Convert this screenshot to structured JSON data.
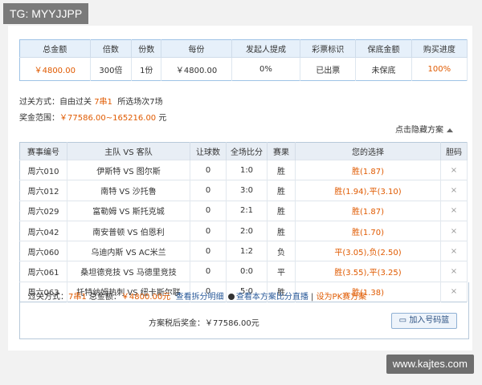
{
  "watermark_top": "TG: MYYJJPP",
  "watermark_bottom": "www.kajtes.com",
  "summary": {
    "headers": [
      "总金额",
      "倍数",
      "份数",
      "每份",
      "发起人提成",
      "彩票标识",
      "保底金额",
      "购买进度"
    ],
    "values": [
      "￥4800.00",
      "300倍",
      "1份",
      "￥4800.00",
      "0%",
      "已出票",
      "未保底",
      "100%"
    ]
  },
  "pass_mode_label": "过关方式：自由过关",
  "pass_mode_value": "7串1",
  "pass_mode_extra": "所选场次7场",
  "prize_range_label": "奖金范围：",
  "prize_range_value": "￥77586.00~165216.00",
  "prize_range_unit": "元",
  "toggle_label": "点击隐藏方案",
  "matches": {
    "headers": [
      "赛事编号",
      "主队 VS 客队",
      "让球数",
      "全场比分",
      "赛果",
      "您的选择",
      "胆码"
    ],
    "rows": [
      {
        "id": "周六010",
        "teams": "伊斯特 VS 图尔斯",
        "handicap": "0",
        "score": "1:0",
        "result": "胜",
        "choice": "胜(1.87)",
        "dan": "×"
      },
      {
        "id": "周六012",
        "teams": "南特 VS 沙托鲁",
        "handicap": "0",
        "score": "3:0",
        "result": "胜",
        "choice": "胜(1.94),平(3.10)",
        "dan": "×"
      },
      {
        "id": "周六029",
        "teams": "富勒姆 VS 斯托克城",
        "handicap": "0",
        "score": "2:1",
        "result": "胜",
        "choice": "胜(1.87)",
        "dan": "×"
      },
      {
        "id": "周六042",
        "teams": "南安普顿 VS 伯恩利",
        "handicap": "0",
        "score": "2:0",
        "result": "胜",
        "choice": "胜(1.70)",
        "dan": "×"
      },
      {
        "id": "周六060",
        "teams": "乌迪内斯 VS AC米兰",
        "handicap": "0",
        "score": "1:2",
        "result": "负",
        "choice": "平(3.05),负(2.50)",
        "dan": "×"
      },
      {
        "id": "周六061",
        "teams": "桑坦德竞技 VS 马德里竞技",
        "handicap": "0",
        "score": "0:0",
        "result": "平",
        "choice": "胜(3.55),平(3.25)",
        "dan": "×"
      },
      {
        "id": "周六063",
        "teams": "托特纳姆热刺 VS 纽卡斯尔联",
        "handicap": "0",
        "score": "5:0",
        "result": "胜",
        "choice": "胜(1.38)",
        "dan": "×"
      }
    ]
  },
  "footer": {
    "pass_label": "过关方式：",
    "pass_value": "7串1",
    "total_label": "总金额：",
    "total_value": "￥4800.00元",
    "split_link": "查看拆分明细",
    "live_link": "查看本方案比分直播",
    "pk_link": "设为PK赛方案",
    "after_tax_label": "方案税后奖金：",
    "after_tax_value": "￥77586.00元",
    "add_button": "加入号码篮"
  },
  "colors": {
    "accent": "#e05a00",
    "header_bg": "#e6f0fa",
    "border": "#9ec3e6"
  }
}
